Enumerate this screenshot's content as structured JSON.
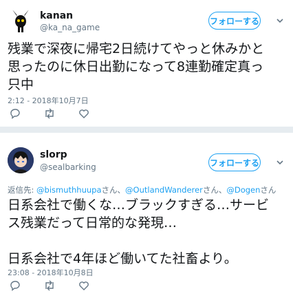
{
  "tweets": [
    {
      "display_name": "kanan",
      "handle": "@ka_na_game",
      "follow_label": "フォローする",
      "text_lines": [
        "残業で深夜に帰宅2日続けてやっと休みかと",
        "思ったのに休日出勤になって8連勤確定真っ",
        "只中"
      ],
      "timestamp": "2:12 - 2018年10月7日"
    },
    {
      "display_name": "slorp",
      "handle": "@sealbarking",
      "follow_label": "フォローする",
      "reply_to": {
        "prefix": "返信先: ",
        "mentions": [
          "@bismuthhuupa",
          "@OutlandWanderer",
          "@Dogen"
        ],
        "suffix": "さん",
        "separator": "、"
      },
      "text_lines": [
        "日系会社で働くな…ブラックすぎる…サービ",
        "ス残業だって日常的な発現…",
        "",
        "日系会社で4年ほど働いてた社畜より。"
      ],
      "timestamp": "23:08 - 2018年10月8日"
    }
  ],
  "icons": {
    "avatar_1": "heartless-character-avatar",
    "avatar_2": "anime-character-avatar",
    "menu": "chevron-down-icon",
    "reply": "reply-icon",
    "retweet": "retweet-icon",
    "like": "heart-icon"
  },
  "colors": {
    "accent": "#1da1f2",
    "secondary_text": "#657786",
    "divider": "#e6ecf0"
  }
}
